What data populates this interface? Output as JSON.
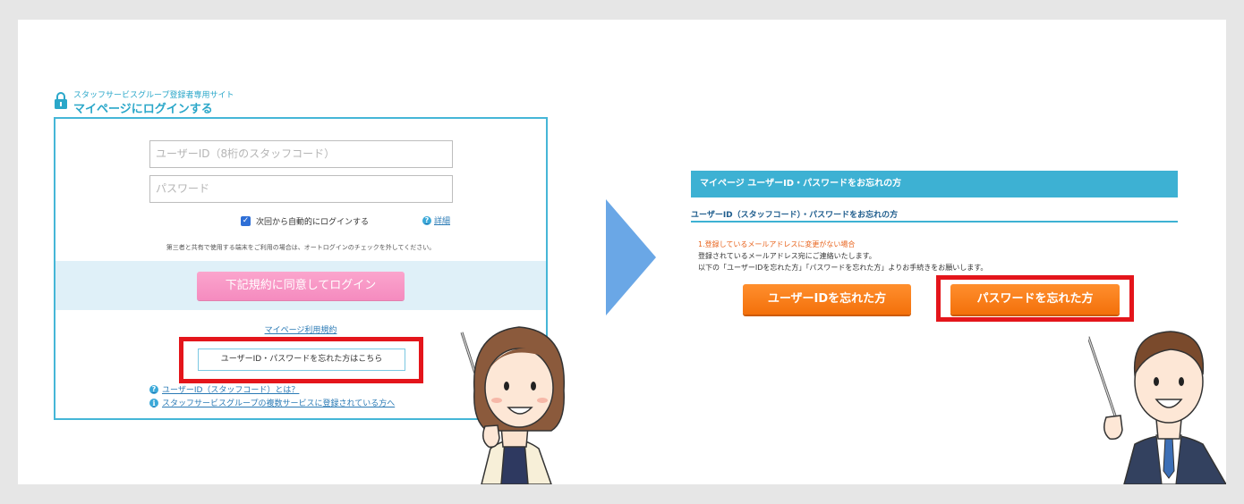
{
  "login": {
    "site_subtitle": "スタッフサービスグループ登録者専用サイト",
    "site_title": "マイページにログインする",
    "userid_placeholder": "ユーザーID（8桁のスタッフコード）",
    "password_placeholder": "パスワード",
    "auto_login_label": "次回から自動的にログインする",
    "auto_login_checked": true,
    "detail_link": "詳細",
    "notice": "第三者と共有で使用する端末をご利用の場合は、オートログインのチェックを外してください。",
    "login_button": "下記規約に同意してログイン",
    "terms_link": "マイページ利用規約",
    "forgot_button": "ユーザーID・パスワードを忘れた方はこちら",
    "help_links": [
      "ユーザーID（スタッフコード）とは？",
      "スタッフサービスグループの複数サービスに登録されている方へ"
    ]
  },
  "forgot": {
    "header": "マイページ ユーザーID・パスワードをお忘れの方",
    "subheader": "ユーザーID（スタッフコード）・パスワードをお忘れの方",
    "orange_text": "1.登録しているメールアドレスに変更がない場合",
    "line2": "登録されているメールアドレス宛にご連絡いたします。",
    "line3": "以下の「ユーザーIDを忘れた方」「パスワードを忘れた方」よりお手続きをお願いします。",
    "userid_button": "ユーザーIDを忘れた方",
    "password_button": "パスワードを忘れた方"
  },
  "colors": {
    "accent_blue": "#3db1d3",
    "highlight_red": "#e4151b",
    "login_pink": "#f58bbf",
    "action_orange": "#f3700a",
    "arrow_blue": "#6aa7e6"
  }
}
